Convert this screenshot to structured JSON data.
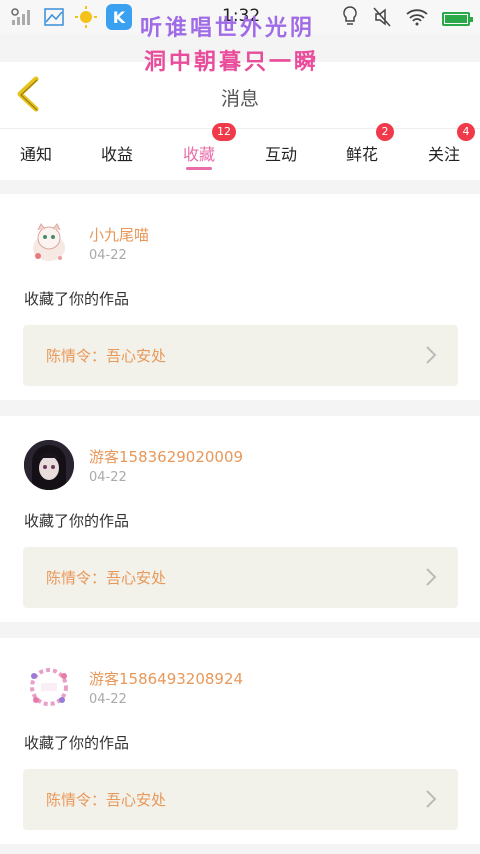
{
  "status_bar": {
    "time": "1:32",
    "icons": [
      "signal-off-icon",
      "gallery-icon",
      "weather-icon",
      "k-app-icon",
      "bulb-icon",
      "mute-icon",
      "wifi-icon",
      "battery-icon"
    ],
    "k_label": "K"
  },
  "overlay": {
    "line1": "听谁唱世外光阴",
    "line2": "洞中朝暮只一瞬"
  },
  "header": {
    "title": "消息",
    "back_icon": "chevron-left-icon"
  },
  "tabs": [
    {
      "label": "通知",
      "badge": ""
    },
    {
      "label": "收益",
      "badge": ""
    },
    {
      "label": "收藏",
      "badge": "12",
      "active": true
    },
    {
      "label": "互动",
      "badge": ""
    },
    {
      "label": "鲜花",
      "badge": "2"
    },
    {
      "label": "关注",
      "badge": "4"
    }
  ],
  "messages": [
    {
      "name": "小九尾喵",
      "date": "04-22",
      "text": "收藏了你的作品",
      "work": "陈情令：吾心安处"
    },
    {
      "name": "游客1583629020009",
      "date": "04-22",
      "text": "收藏了你的作品",
      "work": "陈情令：吾心安处"
    },
    {
      "name": "游客1586493208924",
      "date": "04-22",
      "text": "收藏了你的作品",
      "work": "陈情令：吾心安处"
    }
  ],
  "colors": {
    "accent_pink": "#e86da8",
    "username_orange": "#e8985a",
    "badge_red": "#f03a4a",
    "back_yellow": "#e8c21a",
    "work_bg": "#f3f2ea"
  }
}
